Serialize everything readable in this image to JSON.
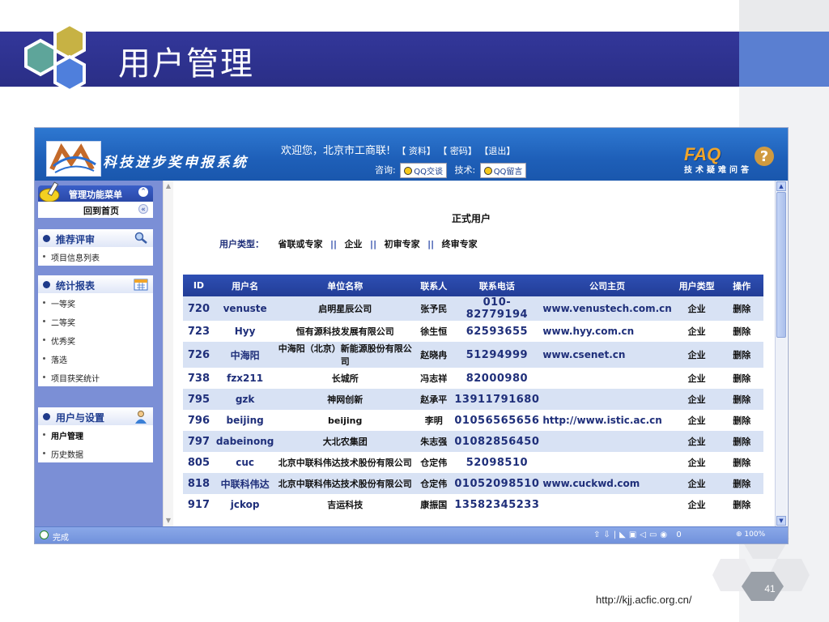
{
  "slide": {
    "title": "用户管理",
    "url": "http://kjj.acfic.org.cn/",
    "page_number": "41"
  },
  "app": {
    "logo_text": "科技进步奖申报系统",
    "welcome": "欢迎您，北京市工商联!",
    "links": [
      "【 资料】",
      "【 密码】",
      "【退出】"
    ],
    "consult_label": "咨询:",
    "qq_chat": "QQ交谈",
    "tech_label": "技术:",
    "qq_message": "QQ留言",
    "faq_big": "FAQ",
    "faq_sub": "技术疑难问答"
  },
  "sidebar": {
    "menu_title": "管理功能菜单",
    "home": "回到首页",
    "sections": [
      {
        "title": "推荐评审",
        "icon": "magnifier-icon",
        "items": [
          {
            "label": "项目信息列表",
            "active": false
          }
        ]
      },
      {
        "title": "统计报表",
        "icon": "calendar-icon",
        "items": [
          {
            "label": "一等奖",
            "active": false
          },
          {
            "label": "二等奖",
            "active": false
          },
          {
            "label": "优秀奖",
            "active": false
          },
          {
            "label": "落选",
            "active": false
          },
          {
            "label": "项目获奖统计",
            "active": false
          }
        ]
      },
      {
        "title": "用户与设置",
        "icon": "user-icon",
        "items": [
          {
            "label": "用户管理",
            "active": true
          },
          {
            "label": "历史数据",
            "active": false
          }
        ]
      }
    ]
  },
  "content": {
    "title": "正式用户",
    "user_type_label": "用户类型：",
    "user_types": [
      "省联或专家",
      "企业",
      "初审专家",
      "终审专家"
    ],
    "table": {
      "headers": [
        "ID",
        "用户名",
        "单位名称",
        "联系人",
        "联系电话",
        "公司主页",
        "用户类型",
        "操作"
      ],
      "rows": [
        [
          "720",
          "venuste",
          "启明星辰公司",
          "张予民",
          "010-82779194",
          "www.venustech.com.cn",
          "企业",
          "删除"
        ],
        [
          "723",
          "Hyy",
          "恒有源科技发展有限公司",
          "徐生恒",
          "62593655",
          "www.hyy.com.cn",
          "企业",
          "删除"
        ],
        [
          "726",
          "中海阳",
          "中海阳（北京）新能源股份有限公司",
          "赵晓冉",
          "51294999",
          "www.csenet.cn",
          "企业",
          "删除"
        ],
        [
          "738",
          "fzx211",
          "长城所",
          "冯志祥",
          "82000980",
          "",
          "企业",
          "删除"
        ],
        [
          "795",
          "gzk",
          "神网创新",
          "赵承平",
          "13911791680",
          "",
          "企业",
          "删除"
        ],
        [
          "796",
          "beijing",
          "beijing",
          "李明",
          "01056565656",
          "http://www.istic.ac.cn",
          "企业",
          "删除"
        ],
        [
          "797",
          "dabeinong",
          "大北农集团",
          "朱志强",
          "01082856450",
          "",
          "企业",
          "删除"
        ],
        [
          "805",
          "cuc",
          "北京中联科伟达技术股份有限公司",
          "仓定伟",
          "52098510",
          "",
          "企业",
          "删除"
        ],
        [
          "818",
          "中联科伟达",
          "北京中联科伟达技术股份有限公司",
          "仓定伟",
          "01052098510",
          "www.cuckwd.com",
          "企业",
          "删除"
        ],
        [
          "917",
          "jckop",
          "吉运科技",
          "康振国",
          "13582345233",
          "",
          "企业",
          "删除"
        ]
      ]
    }
  },
  "status": {
    "text": "完成",
    "zoom": "100%",
    "count": "0"
  },
  "colors": {
    "banner": "#2e3192",
    "header": "#1e5fb8",
    "sidebar": "#7b8fd6",
    "table_header": "#2a48a8",
    "row_alt": "#d8e2f4"
  }
}
